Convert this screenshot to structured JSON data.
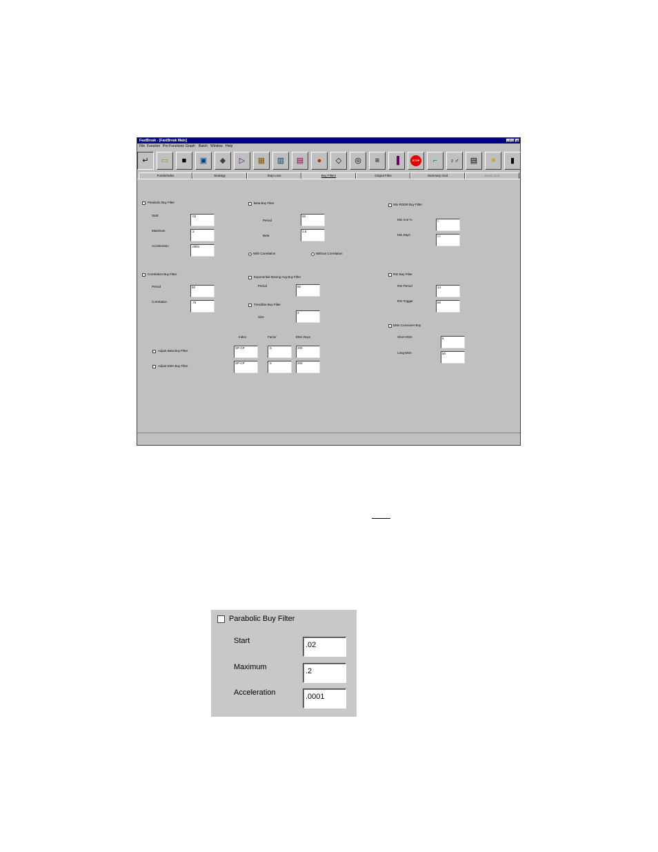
{
  "window": {
    "title": "FastBreak - [FastBreak Main]",
    "controls": [
      "_",
      "□",
      "x"
    ]
  },
  "menu": [
    "File",
    "Function",
    "Pro Functions",
    "Graph",
    "Batch",
    "Window",
    "Help"
  ],
  "toolbar": [
    {
      "icon": "enter-icon",
      "glyph": "↵"
    },
    {
      "icon": "open-folder-icon",
      "glyph": "▭"
    },
    {
      "icon": "save-disk-icon",
      "glyph": "■"
    },
    {
      "icon": "chart-icon",
      "glyph": "▣"
    },
    {
      "icon": "eraser-icon",
      "glyph": "◆"
    },
    {
      "icon": "edit-pen-icon",
      "glyph": "▷"
    },
    {
      "icon": "grid-chart-icon",
      "glyph": "▦"
    },
    {
      "icon": "book-icon",
      "glyph": "▥"
    },
    {
      "icon": "report-icon",
      "glyph": "▤"
    },
    {
      "icon": "color-wheel-icon",
      "glyph": "●"
    },
    {
      "icon": "diamond-icon",
      "glyph": "◇"
    },
    {
      "icon": "clock-icon",
      "glyph": "◎"
    },
    {
      "icon": "network-icon",
      "glyph": "≡"
    },
    {
      "icon": "bar-graph-icon",
      "glyph": "▐"
    },
    {
      "icon": "stop-sign-icon",
      "glyph": "STOP"
    },
    {
      "icon": "hook-icon",
      "glyph": "⌐"
    },
    {
      "icon": "people-icon",
      "glyph": "♀♂"
    },
    {
      "icon": "monitor-icon",
      "glyph": "▤"
    },
    {
      "icon": "lightbulb-icon",
      "glyph": "☀"
    },
    {
      "icon": "exit-door-icon",
      "glyph": "▮"
    }
  ],
  "tabs": [
    {
      "label": "Funds/Index",
      "state": "normal"
    },
    {
      "label": "Strategy",
      "state": "normal"
    },
    {
      "label": "Stop Loss",
      "state": "normal"
    },
    {
      "label": "Buy Filters",
      "state": "active"
    },
    {
      "label": "Output Files",
      "state": "normal"
    },
    {
      "label": "Summary Grid",
      "state": "normal"
    },
    {
      "label": "Detail Grid",
      "state": "disabled"
    }
  ],
  "buy_filters": {
    "parabolic": {
      "label": "Parabolic Buy Filter",
      "start_label": "Start",
      "start": ".02",
      "maximum_label": "Maximum",
      "maximum": ".2",
      "acceleration_label": "Acceleration",
      "acceleration": ".0001"
    },
    "correlation": {
      "label": "Correlation Buy Filter",
      "period_label": "Period",
      "period": "50",
      "correlation_label": "Correlation",
      "correlation": ".75"
    },
    "beta": {
      "label": "Beta Buy Filter",
      "period_label": "Period",
      "period": "50",
      "beta_label": "Beta",
      "beta": "1.5",
      "with_label": "With Correlation",
      "without_label": "Without Correlation"
    },
    "ema_moving": {
      "label": "Exponential Moving Avg Buy Filter",
      "period_label": "Period",
      "period": "50"
    },
    "trendline": {
      "label": "Trendline Buy Filter",
      "size_label": "Size",
      "size": "3"
    },
    "adjust": {
      "headers": [
        "Index",
        "Factor",
        "EMA Days"
      ],
      "beta_label": "Adjust Beta Buy Filter",
      "beta_values": [
        "SP-CP",
        ".5",
        "200"
      ],
      "ema_label": "Adjust EMA Buy Filter",
      "ema_values": [
        "SP-CP",
        ".5",
        "200"
      ]
    },
    "min_rodr": {
      "label": "Min RODR Buy Filter",
      "min_ann_label": "Min Ann %",
      "min_ann": "5",
      "min_days_label": "Min Days",
      "min_days": "50"
    },
    "rsi": {
      "label": "RSI Buy Filter",
      "period_label": "RSI Period",
      "period": "14",
      "trigger_label": "RSI Trigger",
      "trigger": "50"
    },
    "ema_crossover": {
      "label": "EMA Crossover Buy",
      "short_label": "Short EMA",
      "short": "5",
      "long_label": "Long EMA",
      "long": "50"
    }
  },
  "zoom": {
    "label": "Parabolic Buy Filter",
    "start_label": "Start",
    "start": ".02",
    "maximum_label": "Maximum",
    "maximum": ".2",
    "acceleration_label": "Acceleration",
    "acceleration": ".0001"
  }
}
